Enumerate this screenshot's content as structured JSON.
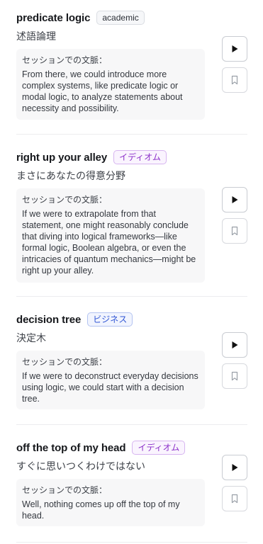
{
  "excerpt_label": "セッションでの文脈：",
  "cards": [
    {
      "term": "predicate logic",
      "tag": "academic",
      "translation": "述語論理",
      "excerpt": "From there, we could introduce more complex systems, like predicate logic or modal logic, to analyze statements about necessity and possibility."
    },
    {
      "term": "right up your alley",
      "tag": "イディオム",
      "translation": "まさにあなたの得意分野",
      "excerpt": "If we were to extrapolate from that statement, one might reasonably conclude that diving into logical frameworks—like formal logic, Boolean algebra, or even the intricacies of quantum mechanics—might be right up your alley."
    },
    {
      "term": "decision tree",
      "tag": "ビジネス",
      "translation": "決定木",
      "excerpt": "If we were to deconstruct everyday decisions using logic, we could start with a decision tree."
    },
    {
      "term": "off the top of my head",
      "tag": "イディオム",
      "translation": "すぐに思いつくわけではない",
      "excerpt": "Well, nothing comes up off the top of my head."
    }
  ],
  "icons": {
    "play": "play-icon",
    "save": "bookmark-icon"
  },
  "colors": {
    "idiom_tag": "#8b2fc9",
    "business_tag": "#2f55d4",
    "academic_tag": "#2b2f36"
  }
}
